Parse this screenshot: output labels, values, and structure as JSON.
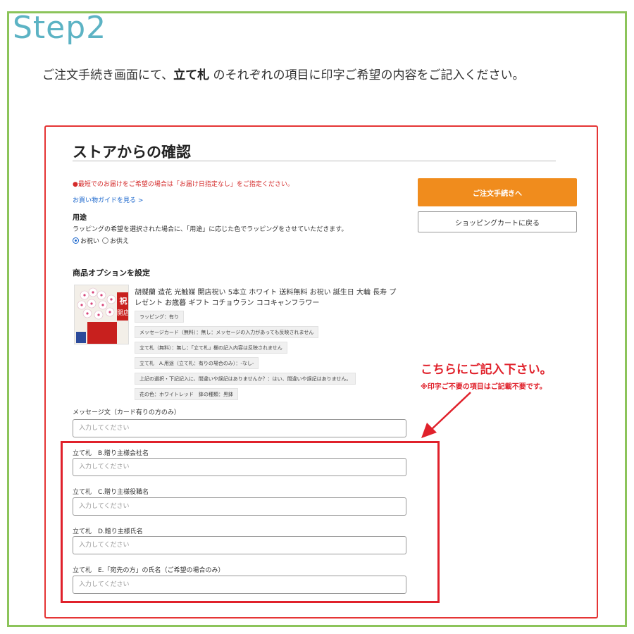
{
  "step_title": "Step2",
  "instruction": {
    "before": "ご注文手続き画面にて、",
    "emphasis": "立て札",
    "after": " のそれぞれの項目に印字ご希望の内容をご記入ください。"
  },
  "panel": {
    "heading": "ストアからの確認",
    "notice": "●最短でのお届けをご希望の場合は「お届け日指定なし」をご指定ください。",
    "guide_link": "お買い物ガイドを見る >",
    "usage_label": "用途",
    "usage_desc": "ラッピングの希望を選択された場合に、「用途」に応じた色でラッピングをさせていただきます。",
    "radio_options": [
      "お祝い",
      "お供え"
    ],
    "radio_selected": "お祝い",
    "checkout_button": "ご注文手続きへ",
    "cart_button": "ショッピングカートに戻る",
    "options_heading": "商品オプションを設定",
    "product_name": "胡蝶蘭 造花 光触媒 開店祝い 5本立 ホワイト 送料無料 お祝い 誕生日 大輪 長寿 プレゼント お歳暮 ギフト コチョウラン ココキャンフラワー",
    "product_image_alt": "祝 開店",
    "option_tags": [
      "ラッピング：有り",
      "メッセージカード（無料）：無し：メッセージの入力があっても反映されません",
      "立て札（無料）：無し：「立て札」欄の記入内容は反映されません",
      "立て札　A.用途（立て札：有りの場合のみ）：-なし-",
      "上記の選択・下記記入に、間違いや誤記はありませんか？：はい、間違いや誤記はありません。",
      "花の色：ホワイトレッド　鉢の種類：黒鉢"
    ],
    "fields": [
      {
        "label": "メッセージ文（カード有りの方のみ）",
        "placeholder": "入力してください"
      },
      {
        "label": "立て札　B.贈り主様会社名",
        "placeholder": "入力してください"
      },
      {
        "label": "立て札　C.贈り主様役職名",
        "placeholder": "入力してください"
      },
      {
        "label": "立て札　D.贈り主様氏名",
        "placeholder": "入力してください"
      },
      {
        "label": "立て札　E.「宛先の方」の氏名（ご希望の場合のみ）",
        "placeholder": "入力してください"
      }
    ]
  },
  "callout": {
    "main": "こちらにご記入下さい。",
    "sub": "※印字ご不要の項目はご記載不要です。"
  },
  "colors": {
    "frame": "#8cc45a",
    "step_title": "#5cb3c4",
    "highlight": "#e0212b",
    "checkout": "#f08c1d"
  }
}
